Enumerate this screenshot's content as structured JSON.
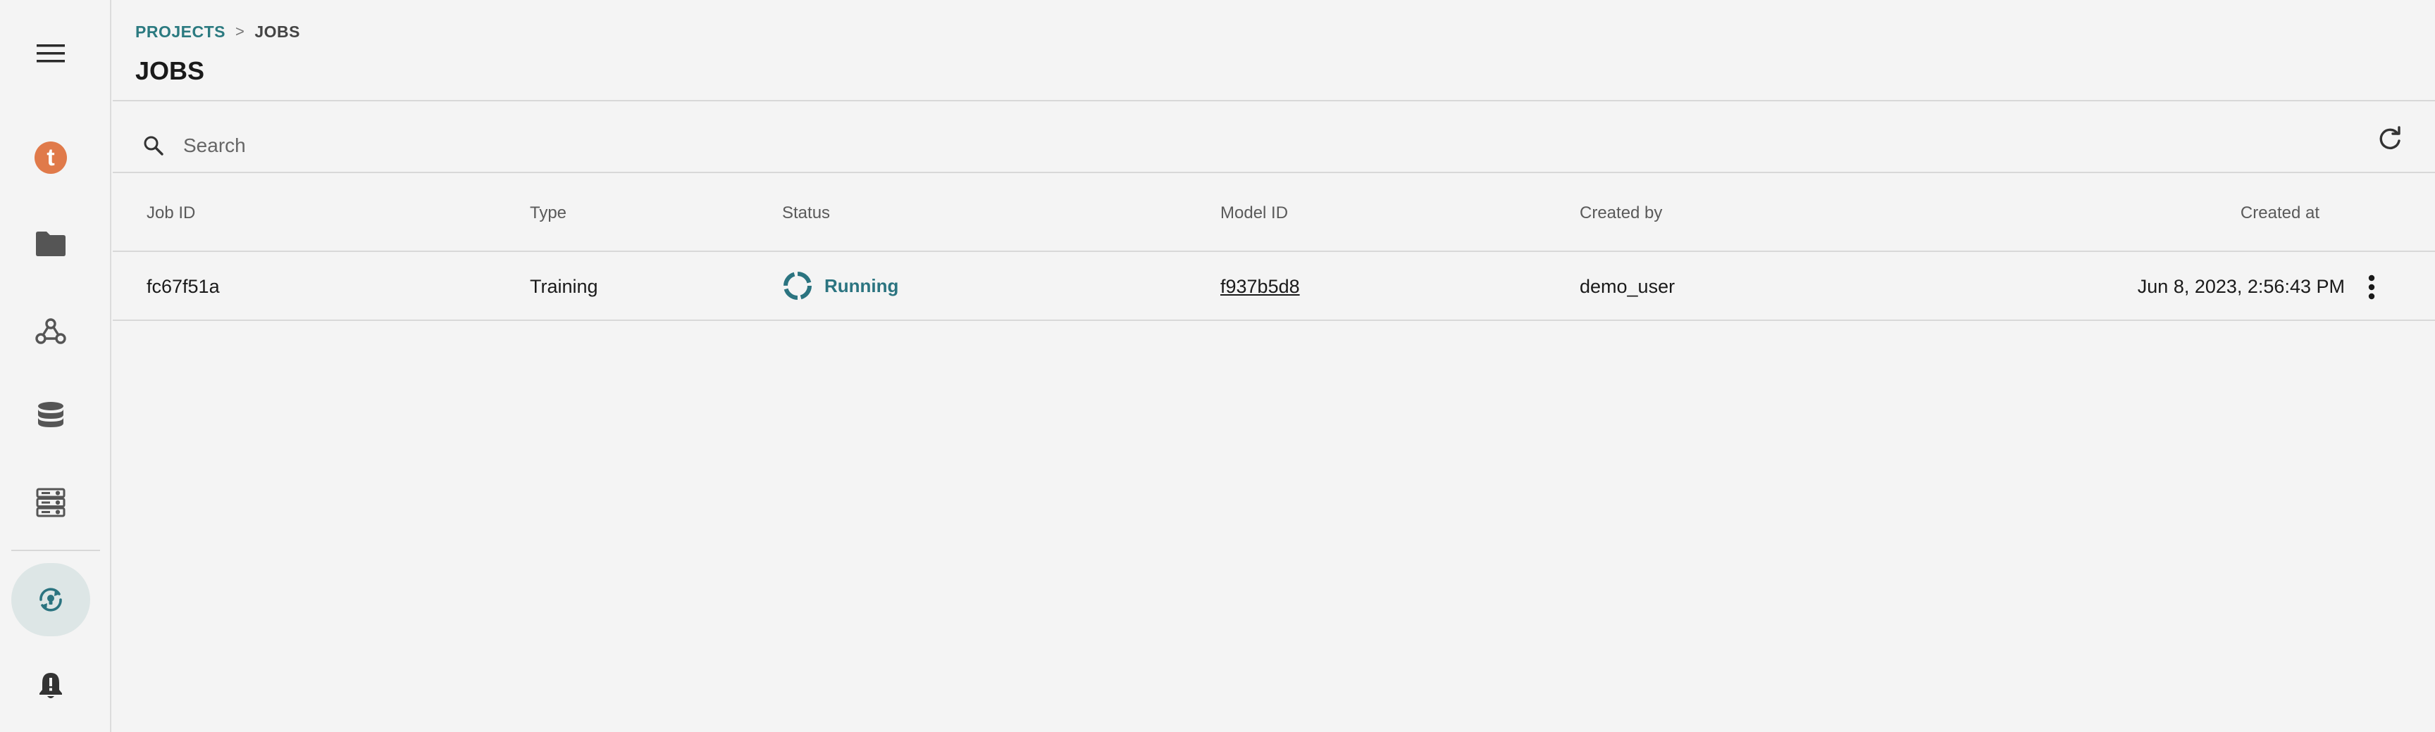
{
  "breadcrumb": {
    "parent": "PROJECTS",
    "separator": ">",
    "current": "JOBS"
  },
  "page": {
    "title": "JOBS"
  },
  "search": {
    "placeholder": "Search",
    "value": ""
  },
  "sidebar": {
    "items": [
      {
        "name": "menu",
        "icon": "hamburger-menu-icon"
      },
      {
        "name": "tenant",
        "icon": "t-logo-icon",
        "letter": "t"
      },
      {
        "name": "projects",
        "icon": "folder-icon"
      },
      {
        "name": "integrations",
        "icon": "webhook-icon"
      },
      {
        "name": "datasets",
        "icon": "database-icon"
      },
      {
        "name": "models",
        "icon": "server-rack-icon"
      },
      {
        "name": "jobs",
        "icon": "refresh-lightbulb-icon",
        "active": true
      },
      {
        "name": "notifications",
        "icon": "bell-alert-icon"
      }
    ]
  },
  "table": {
    "columns": [
      "Job ID",
      "Type",
      "Status",
      "Model ID",
      "Created by",
      "Created at"
    ],
    "rows": [
      {
        "job_id": "fc67f51a",
        "type": "Training",
        "status": "Running",
        "model_id": "f937b5d8",
        "created_by": "demo_user",
        "created_at": "Jun 8, 2023, 2:56:43 PM"
      }
    ]
  },
  "colors": {
    "accent": "#2b7a80",
    "status_running": "#2b7480",
    "tenant_logo": "#e07a4a",
    "active_nav_bg": "#dde6e6",
    "background": "#f4f4f4"
  }
}
